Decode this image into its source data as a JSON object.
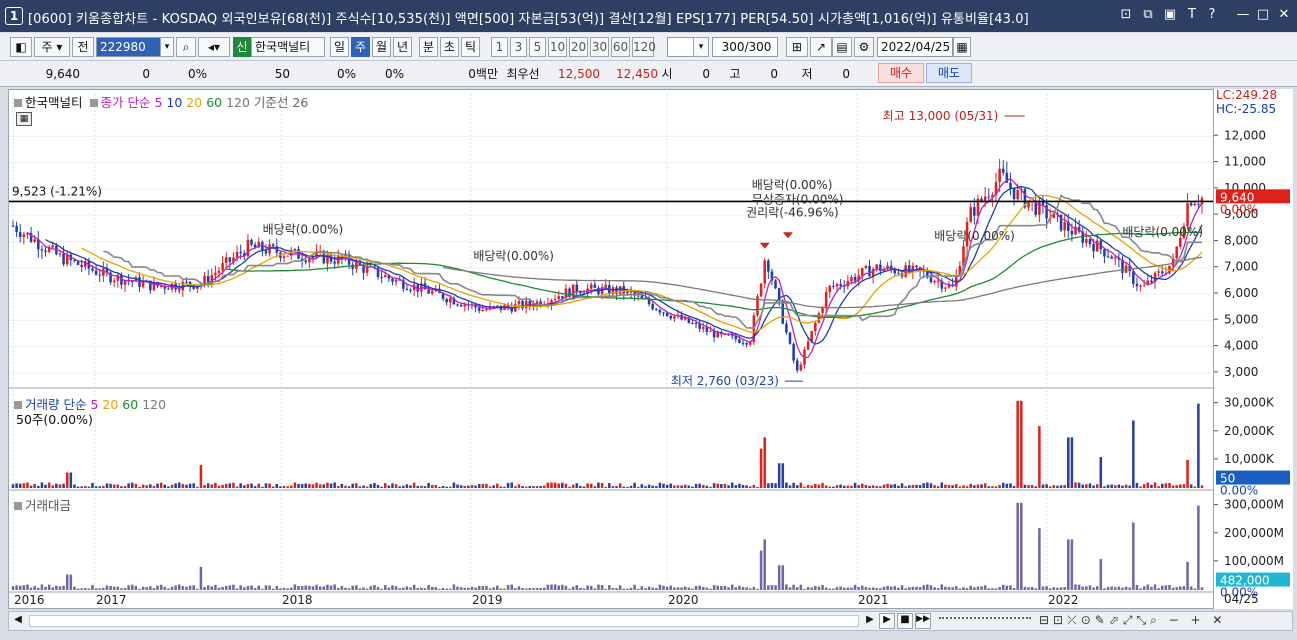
{
  "title": {
    "window_number": "1",
    "text": "[0600] 키움종합차트 - KOSDAQ 외국인보유[68(천)] 주식수[10,535(천)] 액면[500] 자본금[53(억)] 결산[12월] EPS[177] PER[54.50] 시가총액[1,016(억)] 유통비율[43.0]"
  },
  "toolbar": {
    "period_type": "주",
    "view_label": "전",
    "stock_code": "222980",
    "market_badge": "신",
    "stock_name": "한국맥널티",
    "period_tabs": [
      "일",
      "주",
      "월",
      "년",
      "분",
      "초",
      "틱"
    ],
    "active_period": "주",
    "interval_buttons": [
      "1",
      "3",
      "5",
      "10",
      "20",
      "30",
      "60",
      "120"
    ],
    "count_value": "300/300",
    "date_value": "2022/04/25"
  },
  "quote_bar": {
    "price": "9,640",
    "change": "0",
    "change_pct": "0%",
    "volume": "50",
    "vol_pct": "0%",
    "turnover_pct": "0%",
    "amount": "0백만",
    "best_label": "최우선",
    "ask": "12,500",
    "bid": "12,450",
    "open_label": "시",
    "open": "0",
    "high_label": "고",
    "high": "0",
    "low_label": "저",
    "low": "0",
    "buy_button": "매수",
    "sell_button": "매도"
  },
  "price_panel": {
    "legend_name": "한국맥널티",
    "legend_ma_label": "종가 단순",
    "legend_ma": [
      "5",
      "10",
      "20",
      "60",
      "120"
    ],
    "legend_base": "기준선 26",
    "ref_line_label": "9,523 (-1.21%)",
    "high_annot": "최고 13,000 (05/31)",
    "low_annot": "최저 2,760 (03/23)",
    "events": [
      "배당락(0.00%)",
      "배당락(0.00%)",
      "배당락(0.00%)",
      "무상증자(0.00%)",
      "권리락(-46.96%)",
      "배당락(0.00%)",
      "배당락(0.00%)"
    ],
    "lc_label": "LC:249.28",
    "hc_label": "HC:-25.85",
    "price_tag": "9,640",
    "pct_tag": "0.00%",
    "y_ticks": [
      "12,000",
      "11,000",
      "10,000",
      "9,000",
      "8,000",
      "7,000",
      "6,000",
      "5,000",
      "4,000",
      "3,000"
    ]
  },
  "volume_panel": {
    "legend": "거래량 단순",
    "legend_ma": [
      "5",
      "20",
      "60",
      "120"
    ],
    "sub_legend": "50주(0.00%)",
    "y_ticks": [
      "30,000K",
      "20,000K",
      "10,000K"
    ],
    "value_tag": "50",
    "pct_tag": "0.00%"
  },
  "amount_panel": {
    "legend": "거래대금",
    "y_ticks": [
      "300,000M",
      "200,000M",
      "100,000M"
    ],
    "value_tag": "482,000",
    "pct_tag": "0.00%"
  },
  "x_axis": {
    "labels": [
      "2016",
      "2017",
      "2018",
      "2019",
      "2020",
      "2021",
      "2022"
    ],
    "last_date": "04/25"
  },
  "colors": {
    "title_bg": "#2d3f63",
    "up": "#e0201b",
    "down": "#1a3fb5",
    "ma5": "#c020c0",
    "ma10": "#1a3fb5",
    "ma20": "#e7a400",
    "ma60": "#1e8c2e",
    "ma120": "#7a7a7a",
    "baseline": "#888888"
  },
  "chart_data": {
    "type": "candlestick",
    "title": "",
    "x_range": [
      "2016",
      "2022/04/25"
    ],
    "ylim": [
      2500,
      13000
    ],
    "y_labels": [
      "3,000",
      "4,000",
      "5,000",
      "6,000",
      "7,000",
      "8,000",
      "9,000",
      "10,000",
      "11,000",
      "12,000"
    ],
    "close_series": {
      "name": "종가 (approx.)",
      "x": [
        "2016-01",
        "2016-04",
        "2016-07",
        "2016-10",
        "2017-01",
        "2017-04",
        "2017-07",
        "2017-10",
        "2018-01",
        "2018-04",
        "2018-07",
        "2018-10",
        "2019-01",
        "2019-04",
        "2019-07",
        "2019-10",
        "2019-12",
        "2020-01",
        "2020-03",
        "2020-05",
        "2020-08",
        "2020-11",
        "2021-01",
        "2021-02",
        "2021-04",
        "2021-05",
        "2021-08",
        "2021-11",
        "2022-01",
        "2022-03",
        "2022-04"
      ],
      "values": [
        8600,
        7400,
        6700,
        6300,
        6400,
        7800,
        7500,
        7300,
        6600,
        6000,
        5400,
        5600,
        6200,
        6100,
        5200,
        4400,
        4200,
        7500,
        3000,
        6200,
        7000,
        6800,
        6200,
        9000,
        10500,
        9800,
        8600,
        7500,
        6200,
        7200,
        9640
      ]
    },
    "high": 13000,
    "low": 2760
  }
}
